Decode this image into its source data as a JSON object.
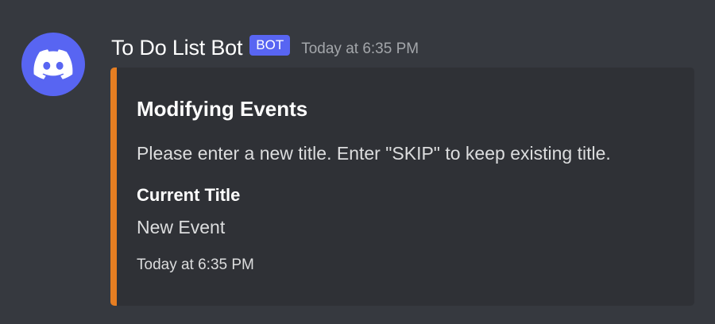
{
  "message": {
    "username": "To Do List Bot",
    "bot_tag": "BOT",
    "timestamp": "Today at 6:35 PM",
    "avatar_icon": "discord-logo-icon"
  },
  "embed": {
    "accent_color": "#e67e22",
    "title": "Modifying Events",
    "description": "Please enter a new title. Enter \"SKIP\" to keep existing title.",
    "fields": [
      {
        "name": "Current Title",
        "value": "New Event"
      }
    ],
    "footer_timestamp": "Today at 6:35 PM"
  },
  "colors": {
    "background": "#36393f",
    "embed_background": "#2f3136",
    "blurple": "#5865f2"
  }
}
